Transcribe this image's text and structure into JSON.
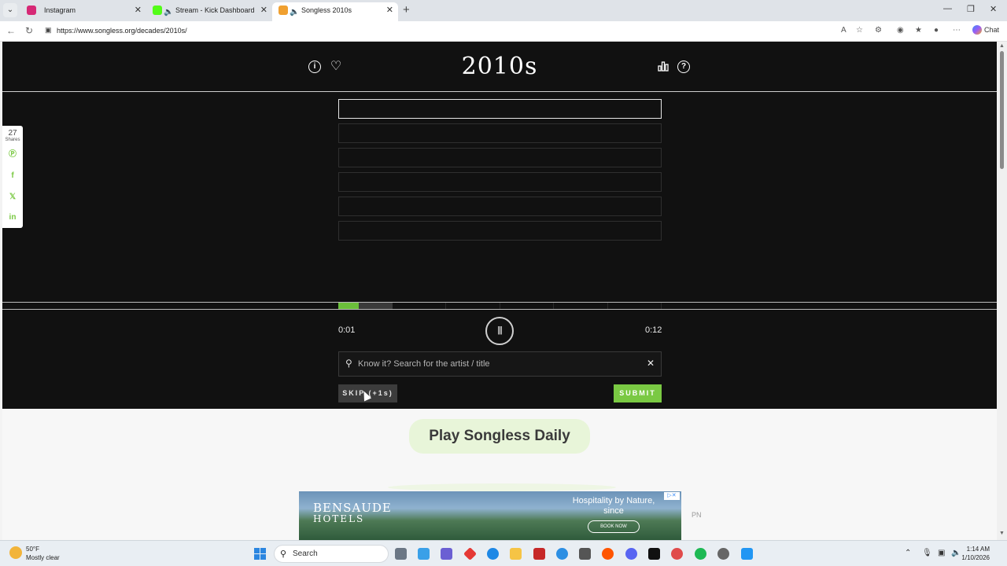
{
  "browser": {
    "tabs": [
      {
        "title": "Instagram",
        "favicon_color": "#d62976",
        "muted": false,
        "active": false
      },
      {
        "title": "Stream - Kick Dashboard",
        "favicon_color": "#53fc18",
        "muted": true,
        "active": false
      },
      {
        "title": "Songless 2010s",
        "favicon_color": "#f0a030",
        "muted": true,
        "active": true
      }
    ],
    "url": "https://www.songless.org/decades/2010s/",
    "chat_label": "Chat"
  },
  "game": {
    "title": "2010s",
    "guess_slots": 6,
    "current_slot": 1,
    "time_elapsed": "0:01",
    "time_total": "0:12",
    "progress": {
      "played_fraction": 0.0625,
      "unlocked_fraction": 0.1667,
      "segments": 6
    },
    "search_placeholder": "Know it? Search for the artist / title",
    "skip_label": "SKIP (+1s)",
    "submit_label": "SUBMIT"
  },
  "share": {
    "count": "27",
    "label": "Shares"
  },
  "promo": {
    "daily_label": "Play Songless Daily"
  },
  "ad": {
    "brand_line1": "BENSAUDE",
    "brand_line2": "HOTELS",
    "tagline": "Hospitality by Nature, since",
    "cta": "BOOK NOW",
    "side_text": "PN"
  },
  "taskbar": {
    "weather_temp": "50°F",
    "weather_desc": "Mostly clear",
    "search_label": "Search",
    "time": "1:14 AM",
    "date": "1/10/2026"
  },
  "colors": {
    "accent": "#7ac943",
    "game_bg": "#111111",
    "daily_bg": "#e8f5d9"
  }
}
